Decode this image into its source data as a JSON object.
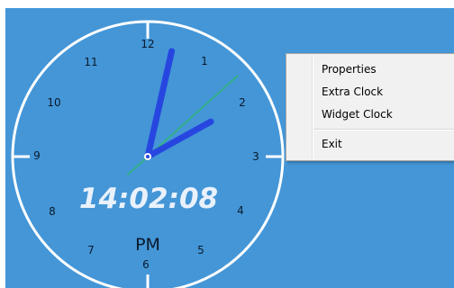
{
  "colors": {
    "desktop": "#4496d7",
    "hand": "#2746e0",
    "second_hand": "#35b08a",
    "ring": "#ffffff"
  },
  "clock": {
    "time": "14:02:08",
    "ampm": "PM",
    "numbers": [
      "12",
      "1",
      "2",
      "3",
      "4",
      "5",
      "6",
      "7",
      "8",
      "9",
      "10",
      "11"
    ],
    "hour": 2,
    "minute": 2,
    "second": 8
  },
  "menu": {
    "items": [
      "Properties",
      "Extra Clock",
      "Widget Clock"
    ],
    "exit": "Exit"
  }
}
